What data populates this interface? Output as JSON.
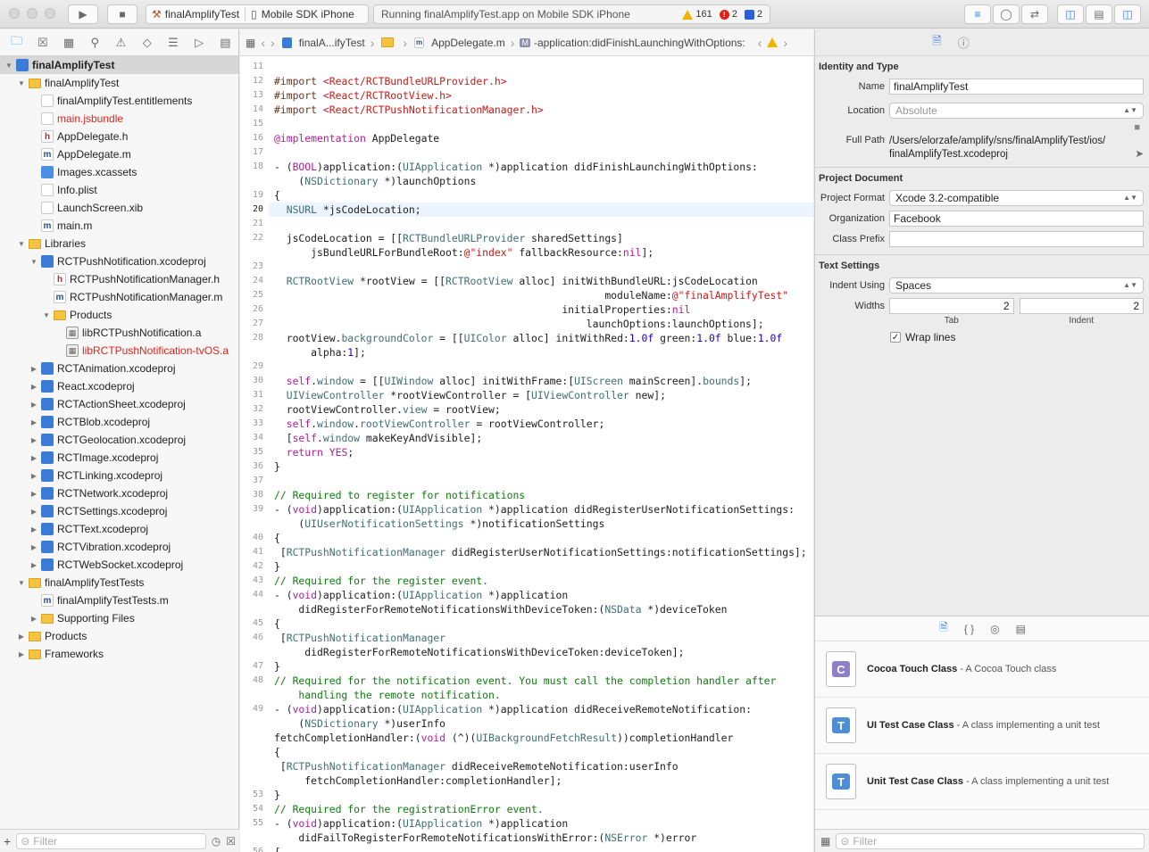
{
  "toolbar": {
    "scheme_target": "finalAmplifyTest",
    "scheme_device": "Mobile SDK iPhone",
    "activity_status": "Running finalAmplifyTest.app on Mobile SDK iPhone",
    "warnings": "161",
    "errors": "2",
    "issues": "2"
  },
  "navigator": {
    "filter_placeholder": "Filter",
    "items": [
      {
        "label": "finalAmplifyTest",
        "depth": 0,
        "icon": "project-icon",
        "disclosure": "open",
        "selected": true,
        "red": false
      },
      {
        "label": "finalAmplifyTest",
        "depth": 1,
        "icon": "folder-icon",
        "disclosure": "open",
        "selected": false,
        "red": false
      },
      {
        "label": "finalAmplifyTest.entitlements",
        "depth": 2,
        "icon": "file-icon",
        "disclosure": "",
        "selected": false,
        "red": false
      },
      {
        "label": "main.jsbundle",
        "depth": 2,
        "icon": "file-icon",
        "disclosure": "",
        "selected": false,
        "red": true
      },
      {
        "label": "AppDelegate.h",
        "depth": 2,
        "icon": "header-icon",
        "disclosure": "",
        "selected": false,
        "red": false
      },
      {
        "label": "AppDelegate.m",
        "depth": 2,
        "icon": "source-icon",
        "disclosure": "",
        "selected": false,
        "red": false
      },
      {
        "label": "Images.xcassets",
        "depth": 2,
        "icon": "assets-icon",
        "disclosure": "",
        "selected": false,
        "red": false
      },
      {
        "label": "Info.plist",
        "depth": 2,
        "icon": "file-icon",
        "disclosure": "",
        "selected": false,
        "red": false
      },
      {
        "label": "LaunchScreen.xib",
        "depth": 2,
        "icon": "file-icon",
        "disclosure": "",
        "selected": false,
        "red": false
      },
      {
        "label": "main.m",
        "depth": 2,
        "icon": "source-icon",
        "disclosure": "",
        "selected": false,
        "red": false
      },
      {
        "label": "Libraries",
        "depth": 1,
        "icon": "folder-icon",
        "disclosure": "open",
        "selected": false,
        "red": false
      },
      {
        "label": "RCTPushNotification.xcodeproj",
        "depth": 2,
        "icon": "project-icon",
        "disclosure": "open",
        "selected": false,
        "red": false
      },
      {
        "label": "RCTPushNotificationManager.h",
        "depth": 3,
        "icon": "header-icon",
        "disclosure": "",
        "selected": false,
        "red": false
      },
      {
        "label": "RCTPushNotificationManager.m",
        "depth": 3,
        "icon": "source-icon",
        "disclosure": "",
        "selected": false,
        "red": false
      },
      {
        "label": "Products",
        "depth": 3,
        "icon": "folder-icon",
        "disclosure": "open",
        "selected": false,
        "red": false
      },
      {
        "label": "libRCTPushNotification.a",
        "depth": 4,
        "icon": "library-icon",
        "disclosure": "",
        "selected": false,
        "red": false
      },
      {
        "label": "libRCTPushNotification-tvOS.a",
        "depth": 4,
        "icon": "library-icon",
        "disclosure": "",
        "selected": false,
        "red": true
      },
      {
        "label": "RCTAnimation.xcodeproj",
        "depth": 2,
        "icon": "project-icon",
        "disclosure": "closed",
        "selected": false,
        "red": false
      },
      {
        "label": "React.xcodeproj",
        "depth": 2,
        "icon": "project-icon",
        "disclosure": "closed",
        "selected": false,
        "red": false
      },
      {
        "label": "RCTActionSheet.xcodeproj",
        "depth": 2,
        "icon": "project-icon",
        "disclosure": "closed",
        "selected": false,
        "red": false
      },
      {
        "label": "RCTBlob.xcodeproj",
        "depth": 2,
        "icon": "project-icon",
        "disclosure": "closed",
        "selected": false,
        "red": false
      },
      {
        "label": "RCTGeolocation.xcodeproj",
        "depth": 2,
        "icon": "project-icon",
        "disclosure": "closed",
        "selected": false,
        "red": false
      },
      {
        "label": "RCTImage.xcodeproj",
        "depth": 2,
        "icon": "project-icon",
        "disclosure": "closed",
        "selected": false,
        "red": false
      },
      {
        "label": "RCTLinking.xcodeproj",
        "depth": 2,
        "icon": "project-icon",
        "disclosure": "closed",
        "selected": false,
        "red": false
      },
      {
        "label": "RCTNetwork.xcodeproj",
        "depth": 2,
        "icon": "project-icon",
        "disclosure": "closed",
        "selected": false,
        "red": false
      },
      {
        "label": "RCTSettings.xcodeproj",
        "depth": 2,
        "icon": "project-icon",
        "disclosure": "closed",
        "selected": false,
        "red": false
      },
      {
        "label": "RCTText.xcodeproj",
        "depth": 2,
        "icon": "project-icon",
        "disclosure": "closed",
        "selected": false,
        "red": false
      },
      {
        "label": "RCTVibration.xcodeproj",
        "depth": 2,
        "icon": "project-icon",
        "disclosure": "closed",
        "selected": false,
        "red": false
      },
      {
        "label": "RCTWebSocket.xcodeproj",
        "depth": 2,
        "icon": "project-icon",
        "disclosure": "closed",
        "selected": false,
        "red": false
      },
      {
        "label": "finalAmplifyTestTests",
        "depth": 1,
        "icon": "folder-icon",
        "disclosure": "open",
        "selected": false,
        "red": false
      },
      {
        "label": "finalAmplifyTestTests.m",
        "depth": 2,
        "icon": "source-icon",
        "disclosure": "",
        "selected": false,
        "red": false
      },
      {
        "label": "Supporting Files",
        "depth": 2,
        "icon": "folder-icon",
        "disclosure": "closed",
        "selected": false,
        "red": false
      },
      {
        "label": "Products",
        "depth": 1,
        "icon": "folder-icon",
        "disclosure": "closed",
        "selected": false,
        "red": false
      },
      {
        "label": "Frameworks",
        "depth": 1,
        "icon": "folder-icon",
        "disclosure": "closed",
        "selected": false,
        "red": false
      }
    ]
  },
  "jumpbar": {
    "project": "finalA...ifyTest",
    "file": "AppDelegate.m",
    "method_badge": "M",
    "method": "-application:didFinishLaunchingWithOptions:"
  },
  "editor": {
    "current_line": "20",
    "lines": [
      {
        "n": "11",
        "html": ""
      },
      {
        "n": "12",
        "html": "<span class=\"p\">#import</span> <span class=\"s\">&lt;React/RCTBundleURLProvider.h&gt;</span>"
      },
      {
        "n": "13",
        "html": "<span class=\"p\">#import</span> <span class=\"s\">&lt;React/RCTRootView.h&gt;</span>"
      },
      {
        "n": "14",
        "html": "<span class=\"p\">#import</span> <span class=\"s\">&lt;React/RCTPushNotificationManager.h&gt;</span>"
      },
      {
        "n": "15",
        "html": ""
      },
      {
        "n": "16",
        "html": "<span class=\"k\">@implementation</span> AppDelegate"
      },
      {
        "n": "17",
        "html": ""
      },
      {
        "n": "18",
        "html": "- (<span class=\"k\">BOOL</span>)application:(<span class=\"t\">UIApplication</span> *)application didFinishLaunchingWithOptions:"
      },
      {
        "n": "",
        "html": "    (<span class=\"t\">NSDictionary</span> *)launchOptions"
      },
      {
        "n": "19",
        "html": "{"
      },
      {
        "n": "20",
        "html": "  <span class=\"t\">NSURL</span> *jsCodeLocation;"
      },
      {
        "n": "21",
        "html": ""
      },
      {
        "n": "22",
        "html": "  jsCodeLocation = [[<span class=\"t\">RCTBundleURLProvider</span> sharedSettings]"
      },
      {
        "n": "",
        "html": "      jsBundleURLForBundleRoot:<span class=\"s\">@\"index\"</span> fallbackResource:<span class=\"k\">nil</span>];"
      },
      {
        "n": "23",
        "html": ""
      },
      {
        "n": "24",
        "html": "  <span class=\"t\">RCTRootView</span> *rootView = [[<span class=\"t\">RCTRootView</span> alloc] initWithBundleURL:jsCodeLocation"
      },
      {
        "n": "25",
        "html": "                                                      moduleName:<span class=\"s\">@\"finalAmplifyTest\"</span>"
      },
      {
        "n": "26",
        "html": "                                               initialProperties:<span class=\"k\">nil</span>"
      },
      {
        "n": "27",
        "html": "                                                   launchOptions:launchOptions];"
      },
      {
        "n": "28",
        "html": "  rootView.<span class=\"t\">backgroundColor</span> = [[<span class=\"t\">UIColor</span> alloc] initWithRed:<span class=\"n\">1.0f</span> green:<span class=\"n\">1.0f</span> blue:<span class=\"n\">1.0f</span>"
      },
      {
        "n": "",
        "html": "      alpha:<span class=\"n\">1</span>];"
      },
      {
        "n": "29",
        "html": ""
      },
      {
        "n": "30",
        "html": "  <span class=\"k\">self</span>.<span class=\"t\">window</span> = [[<span class=\"t\">UIWindow</span> alloc] initWithFrame:[<span class=\"t\">UIScreen</span> mainScreen].<span class=\"t\">bounds</span>];"
      },
      {
        "n": "31",
        "html": "  <span class=\"t\">UIViewController</span> *rootViewController = [<span class=\"t\">UIViewController</span> new];"
      },
      {
        "n": "32",
        "html": "  rootViewController.<span class=\"t\">view</span> = rootView;"
      },
      {
        "n": "33",
        "html": "  <span class=\"k\">self</span>.<span class=\"t\">window</span>.<span class=\"t\">rootViewController</span> = rootViewController;"
      },
      {
        "n": "34",
        "html": "  [<span class=\"k\">self</span>.<span class=\"t\">window</span> makeKeyAndVisible];"
      },
      {
        "n": "35",
        "html": "  <span class=\"k\">return</span> <span class=\"k\">YES</span>;"
      },
      {
        "n": "36",
        "html": "}"
      },
      {
        "n": "37",
        "html": ""
      },
      {
        "n": "38",
        "html": "<span class=\"c\">// Required to register for notifications</span>"
      },
      {
        "n": "39",
        "html": "- (<span class=\"k\">void</span>)application:(<span class=\"t\">UIApplication</span> *)application didRegisterUserNotificationSettings:"
      },
      {
        "n": "",
        "html": "    (<span class=\"t\">UIUserNotificationSettings</span> *)notificationSettings"
      },
      {
        "n": "40",
        "html": "{"
      },
      {
        "n": "41",
        "html": " [<span class=\"t\">RCTPushNotificationManager</span> didRegisterUserNotificationSettings:notificationSettings];"
      },
      {
        "n": "42",
        "html": "}"
      },
      {
        "n": "43",
        "html": "<span class=\"c\">// Required for the register event.</span>"
      },
      {
        "n": "44",
        "html": "- (<span class=\"k\">void</span>)application:(<span class=\"t\">UIApplication</span> *)application"
      },
      {
        "n": "",
        "html": "    didRegisterForRemoteNotificationsWithDeviceToken:(<span class=\"t\">NSData</span> *)deviceToken"
      },
      {
        "n": "45",
        "html": "{"
      },
      {
        "n": "46",
        "html": " [<span class=\"t\">RCTPushNotificationManager</span>"
      },
      {
        "n": "",
        "html": "     didRegisterForRemoteNotificationsWithDeviceToken:deviceToken];"
      },
      {
        "n": "47",
        "html": "}"
      },
      {
        "n": "48",
        "html": "<span class=\"c\">// Required for the notification event. You must call the completion handler after</span>"
      },
      {
        "n": "",
        "html": "<span class=\"c\">    handling the remote notification.</span>"
      },
      {
        "n": "49",
        "html": "- (<span class=\"k\">void</span>)application:(<span class=\"t\">UIApplication</span> *)application didReceiveRemoteNotification:"
      },
      {
        "n": "",
        "html": "    (<span class=\"t\">NSDictionary</span> *)userInfo"
      },
      {
        "n": "",
        "html": "fetchCompletionHandler:(<span class=\"k\">void</span> (^)(<span class=\"t\">UIBackgroundFetchResult</span>))completionHandler"
      },
      {
        "n": "",
        "html": "{"
      },
      {
        "n": "",
        "html": " [<span class=\"t\">RCTPushNotificationManager</span> didReceiveRemoteNotification:userInfo"
      },
      {
        "n": "",
        "html": "     fetchCompletionHandler:completionHandler];"
      },
      {
        "n": "53",
        "html": "}"
      },
      {
        "n": "54",
        "html": "<span class=\"c\">// Required for the registrationError event.</span>"
      },
      {
        "n": "55",
        "html": "- (<span class=\"k\">void</span>)application:(<span class=\"t\">UIApplication</span> *)application"
      },
      {
        "n": "",
        "html": "    didFailToRegisterForRemoteNotificationsWithError:(<span class=\"t\">NSError</span> *)error"
      },
      {
        "n": "56",
        "html": "{"
      }
    ]
  },
  "inspector": {
    "identity_title": "Identity and Type",
    "name_label": "Name",
    "name_value": "finalAmplifyTest",
    "location_label": "Location",
    "location_value": "Absolute",
    "fullpath_label": "Full Path",
    "fullpath_line1": "/Users/elorzafe/amplify/sns/finalAmplifyTest/ios/",
    "fullpath_line2": "finalAmplifyTest.xcodeproj",
    "projdoc_title": "Project Document",
    "format_label": "Project Format",
    "format_value": "Xcode 3.2-compatible",
    "org_label": "Organization",
    "org_value": "Facebook",
    "prefix_label": "Class Prefix",
    "prefix_value": "",
    "text_title": "Text Settings",
    "indent_label": "Indent Using",
    "indent_value": "Spaces",
    "widths_label": "Widths",
    "tab_value": "2",
    "indent_width_value": "2",
    "tab_caption": "Tab",
    "indent_caption": "Indent",
    "wrap_label": "Wrap lines"
  },
  "library": {
    "filter_placeholder": "Filter",
    "items": [
      {
        "title": "Cocoa Touch Class",
        "desc": " - A Cocoa Touch class",
        "glyph": "C",
        "color": "#8e7fc9"
      },
      {
        "title": "UI Test Case Class",
        "desc": " - A class implementing a unit test",
        "glyph": "T",
        "color": "#4e8ed6"
      },
      {
        "title": "Unit Test Case Class",
        "desc": " - A class implementing a unit test",
        "glyph": "T",
        "color": "#4e8ed6"
      }
    ]
  }
}
